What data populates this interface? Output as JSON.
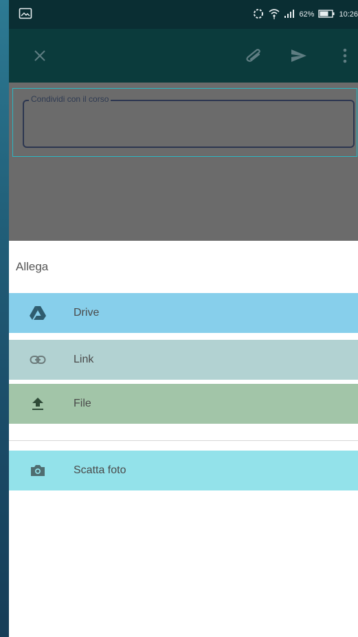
{
  "statusbar": {
    "battery_pct": "62%",
    "time": "10:26",
    "icons": [
      "image-icon",
      "sync-icon",
      "wifi-icon",
      "signal-icon",
      "battery-icon"
    ]
  },
  "toolbar": {
    "icons": [
      "close-icon",
      "attach-icon",
      "send-icon",
      "more-vert-icon"
    ]
  },
  "compose": {
    "field_label": "Condividi con il corso"
  },
  "sheet": {
    "title": "Allega",
    "items": [
      {
        "label": "Drive",
        "icon": "drive-icon",
        "bg": "#87cfeb"
      },
      {
        "label": "Link",
        "icon": "link-icon",
        "bg": "#b2d2d2"
      },
      {
        "label": "File",
        "icon": "upload-icon",
        "bg": "#a2c5a8"
      },
      {
        "label": "Scatta foto",
        "icon": "camera-icon",
        "bg": "#93e2ea"
      }
    ]
  },
  "colors": {
    "statusbar": "#0a2e33",
    "toolbar": "#0b3b3c",
    "scrim": "#6b6b6b",
    "field_focus": "#2bb7c4"
  }
}
